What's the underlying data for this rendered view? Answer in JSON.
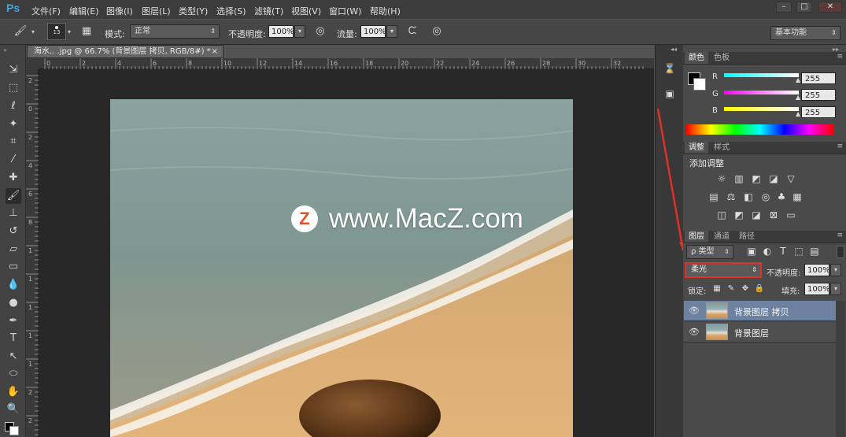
{
  "app": {
    "logo": "Ps"
  },
  "menu": [
    "文件(F)",
    "编辑(E)",
    "图像(I)",
    "图层(L)",
    "类型(Y)",
    "选择(S)",
    "滤镜(T)",
    "视图(V)",
    "窗口(W)",
    "帮助(H)"
  ],
  "window_controls": {
    "minimize": "–",
    "restore": "□",
    "close": "✕"
  },
  "options": {
    "brush_size": "13",
    "mode_label": "模式:",
    "mode_value": "正常",
    "opacity_label": "不透明度:",
    "opacity_value": "100%",
    "flow_label": "流量:",
    "flow_value": "100%",
    "workspace": "基本功能"
  },
  "document": {
    "tab_title": "海水.. .jpg @ 66.7% (背景图层 拷贝, RGB/8#) *",
    "tab_close": "×"
  },
  "ruler": {
    "h_ticks": [
      "0",
      "2",
      "4",
      "6",
      "8",
      "10",
      "12",
      "14",
      "16",
      "18",
      "20",
      "22",
      "24",
      "26",
      "28",
      "30",
      "32"
    ],
    "v_ticks": [
      "2",
      "0",
      "2",
      "4",
      "6",
      "8",
      "1",
      "1",
      "1",
      "1",
      "1",
      "2",
      "2"
    ]
  },
  "watermark": {
    "logo_letter": "Z",
    "text": "www.MacZ.com"
  },
  "color_panel": {
    "tabs": [
      "颜色",
      "色板"
    ],
    "channels": [
      {
        "label": "R",
        "value": "255",
        "color": "#00ffff"
      },
      {
        "label": "G",
        "value": "255",
        "color": "#ff00ff"
      },
      {
        "label": "B",
        "value": "255",
        "color": "#ffff00"
      }
    ],
    "foreground": "#000000",
    "background": "#ffffff"
  },
  "adjustments_panel": {
    "tabs": [
      "调整",
      "样式"
    ],
    "heading": "添加调整",
    "row1_icons": [
      "brightness-icon",
      "levels-icon",
      "curves-icon",
      "exposure-icon",
      "vibrance-icon"
    ],
    "row2_icons": [
      "hue-saturation-icon",
      "color-balance-icon",
      "black-white-icon",
      "photo-filter-icon",
      "channel-mixer-icon",
      "color-lookup-icon"
    ],
    "row3_icons": [
      "invert-icon",
      "posterize-icon",
      "threshold-icon",
      "selective-color-icon",
      "gradient-map-icon"
    ]
  },
  "layers_panel": {
    "tabs": [
      "图层",
      "通道",
      "路径"
    ],
    "filter_label": "ρ 类型",
    "blend_mode": "柔光",
    "opacity_label": "不透明度:",
    "opacity_value": "100%",
    "lock_label": "锁定:",
    "fill_label": "填充:",
    "fill_value": "100%",
    "layers": [
      {
        "name": "背景图层 拷贝",
        "selected": true
      },
      {
        "name": "背景图层",
        "selected": false
      }
    ]
  }
}
